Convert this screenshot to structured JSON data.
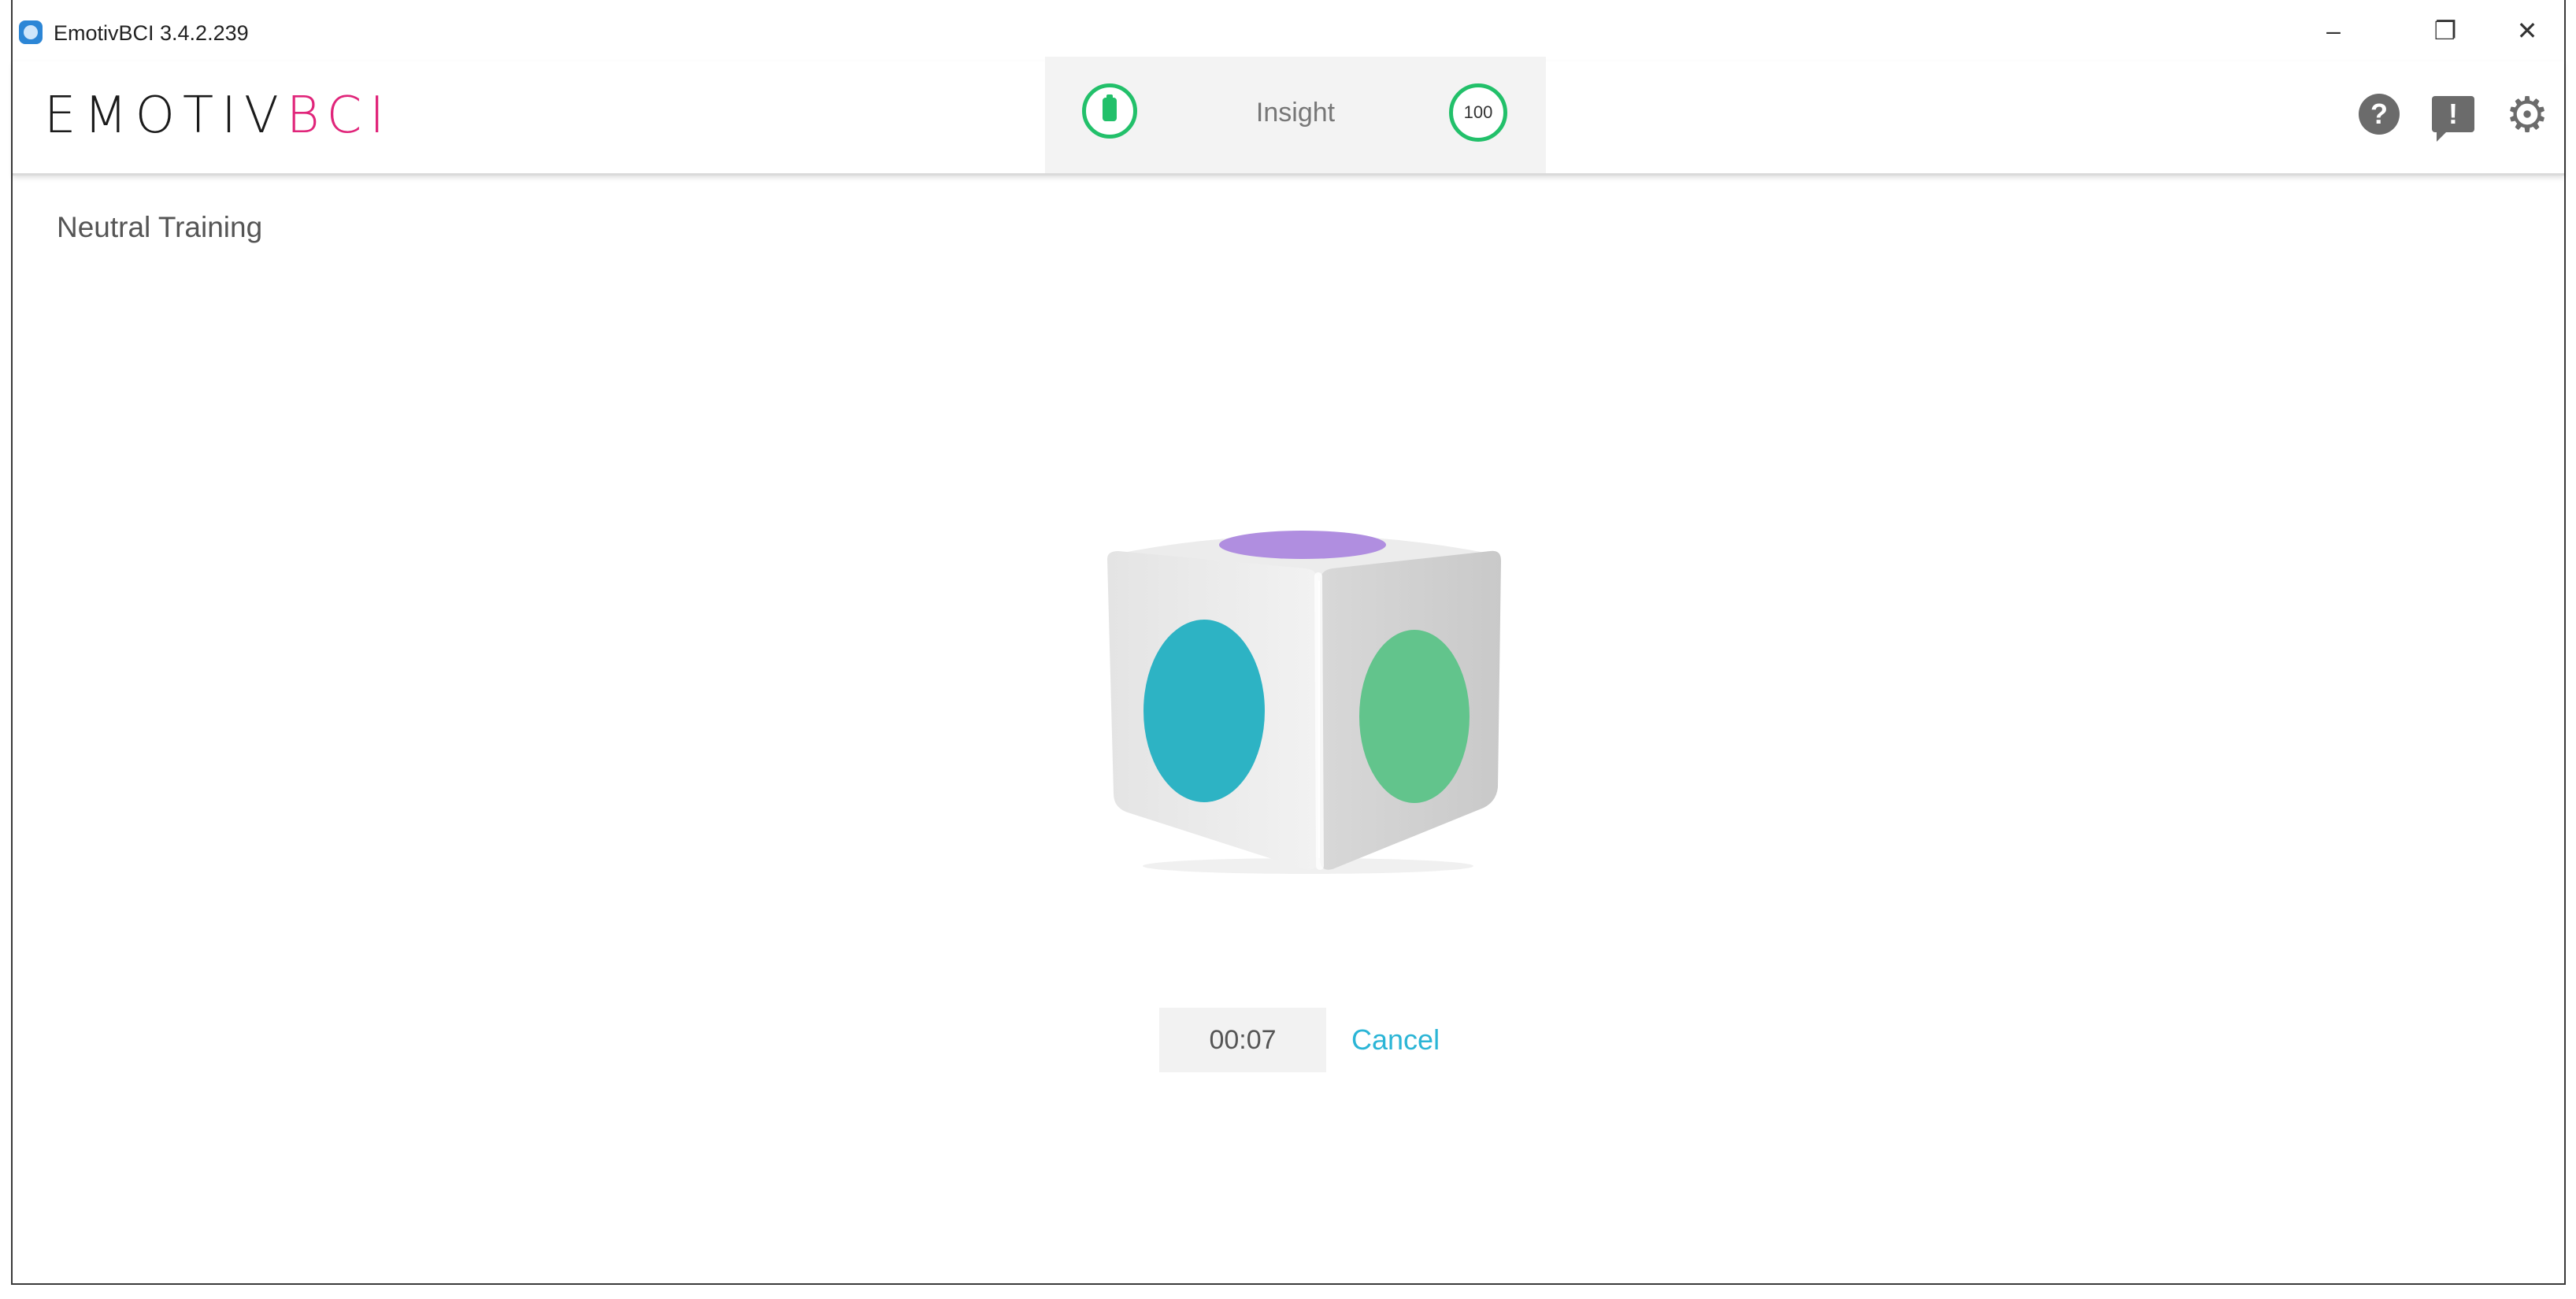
{
  "window": {
    "title": "EmotivBCI 3.4.2.239",
    "controls": {
      "minimize": "–",
      "restore": "❐",
      "close": "✕"
    }
  },
  "header": {
    "logo_part1": "EMOTIV",
    "logo_part2": "BCI",
    "device_name": "Insight",
    "contact_quality": "100",
    "icons": [
      "battery-icon",
      "contact-quality-icon",
      "help-icon",
      "feedback-icon",
      "settings-icon"
    ]
  },
  "content": {
    "title": "Neutral Training",
    "timer": "00:07",
    "cancel_label": "Cancel"
  },
  "colors": {
    "accent_pink": "#e0257a",
    "status_green": "#22c06a",
    "link_blue": "#2bb5d6",
    "cube_left_face_circle": "#2db3c4",
    "cube_right_face_circle": "#62c48c",
    "cube_top_face_circle": "#b08ee0"
  }
}
